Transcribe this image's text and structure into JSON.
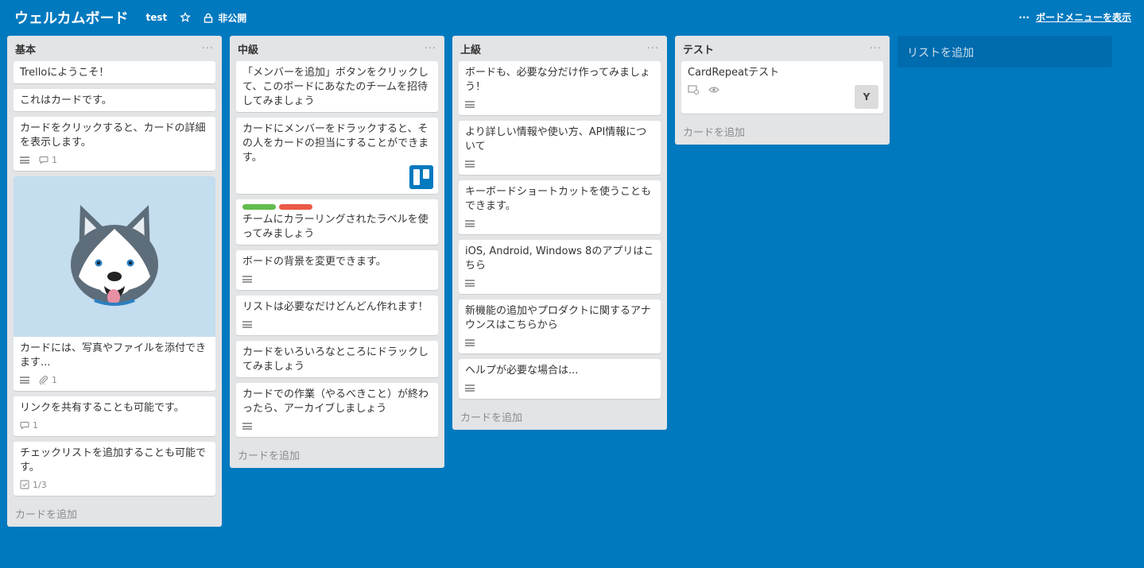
{
  "header": {
    "board_title": "ウェルカムボード",
    "team": "test",
    "visibility": "非公開",
    "menu_link": "ボードメニューを表示"
  },
  "lists": [
    {
      "title": "基本",
      "add_card": "カードを追加",
      "cards": [
        {
          "text": "Trelloにようこそ！"
        },
        {
          "text": "これはカードです。"
        },
        {
          "text": "カードをクリックすると、カードの詳細を表示します。",
          "comments": "1"
        },
        {
          "text": "カードには、写真やファイルを添付できます...",
          "attachments": "1"
        },
        {
          "text": "リンクを共有することも可能です。",
          "comments": "1"
        },
        {
          "text": "チェックリストを追加することも可能です。",
          "checklist": "1/3"
        }
      ]
    },
    {
      "title": "中級",
      "add_card": "カードを追加",
      "cards": [
        {
          "text": "「メンバーを追加」ボタンをクリックして、このボードにあなたのチームを招待してみましょう"
        },
        {
          "text": "カードにメンバーをドラックすると、その人をカードの担当にすることができます。"
        },
        {
          "text": "チームにカラーリングされたラベルを使ってみましょう"
        },
        {
          "text": "ボードの背景を変更できます。"
        },
        {
          "text": "リストは必要なだけどんどん作れます！"
        },
        {
          "text": "カードをいろいろなところにドラックしてみましょう"
        },
        {
          "text": "カードでの作業（やるべきこと）が終わったら、アーカイブしましょう"
        }
      ]
    },
    {
      "title": "上級",
      "add_card": "カードを追加",
      "cards": [
        {
          "text": "ボードも、必要な分だけ作ってみましょう！"
        },
        {
          "text": "より詳しい情報や使い方、API情報について"
        },
        {
          "text": "キーボードショートカットを使うこともできます。"
        },
        {
          "text": "iOS, Android, Windows 8のアプリはこちら"
        },
        {
          "text": "新機能の追加やプロダクトに関するアナウンスはこちらから"
        },
        {
          "text": "ヘルプが必要な場合は..."
        }
      ]
    },
    {
      "title": "テスト",
      "add_card": "カードを追加",
      "cards": [
        {
          "text": "CardRepeatテスト",
          "avatar": "Y"
        }
      ]
    }
  ],
  "add_list": "リストを追加",
  "colors": {
    "board_bg": "#0079bf",
    "label_green": "#61bd4f",
    "label_red": "#eb5a46"
  }
}
